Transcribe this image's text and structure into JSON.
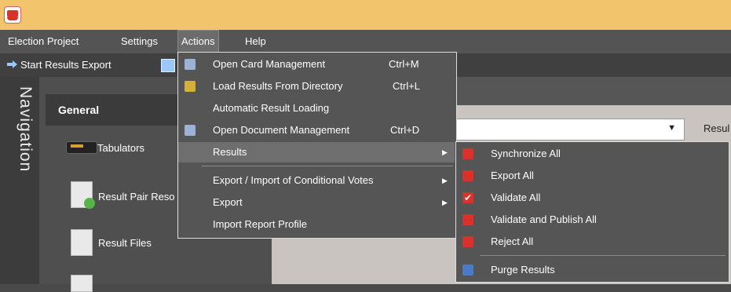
{
  "menubar": {
    "items": [
      {
        "label": "Election Project"
      },
      {
        "label": "Settings"
      },
      {
        "label": "Actions"
      },
      {
        "label": "Help"
      }
    ]
  },
  "toolbar": {
    "start_export": "Start Results Export"
  },
  "navigation": {
    "title": "Navigation",
    "group": "General",
    "items": [
      {
        "label": "Tabulators"
      },
      {
        "label": "Result Pair Reso"
      },
      {
        "label": "Result Files"
      }
    ]
  },
  "content": {
    "label": "Resul"
  },
  "actions_menu": {
    "items": [
      {
        "label": "Open Card Management",
        "shortcut": "Ctrl+M"
      },
      {
        "label": "Load Results From Directory",
        "shortcut": "Ctrl+L"
      },
      {
        "label": "Automatic Result Loading"
      },
      {
        "label": "Open Document Management",
        "shortcut": "Ctrl+D"
      },
      {
        "label": "Results"
      },
      {
        "label": "Export / Import of Conditional Votes"
      },
      {
        "label": "Export"
      },
      {
        "label": "Import Report Profile"
      }
    ]
  },
  "results_submenu": {
    "items": [
      {
        "label": "Synchronize All"
      },
      {
        "label": "Export All"
      },
      {
        "label": "Validate All"
      },
      {
        "label": "Validate and Publish All"
      },
      {
        "label": "Reject All"
      },
      {
        "label": "Purge Results"
      }
    ]
  },
  "colors": {
    "titlebar": "#f2c46c",
    "menubar": "#545454",
    "menu_bg": "#555555",
    "menu_highlight": "#6e6e6e",
    "icon_red": "#d9322b"
  }
}
